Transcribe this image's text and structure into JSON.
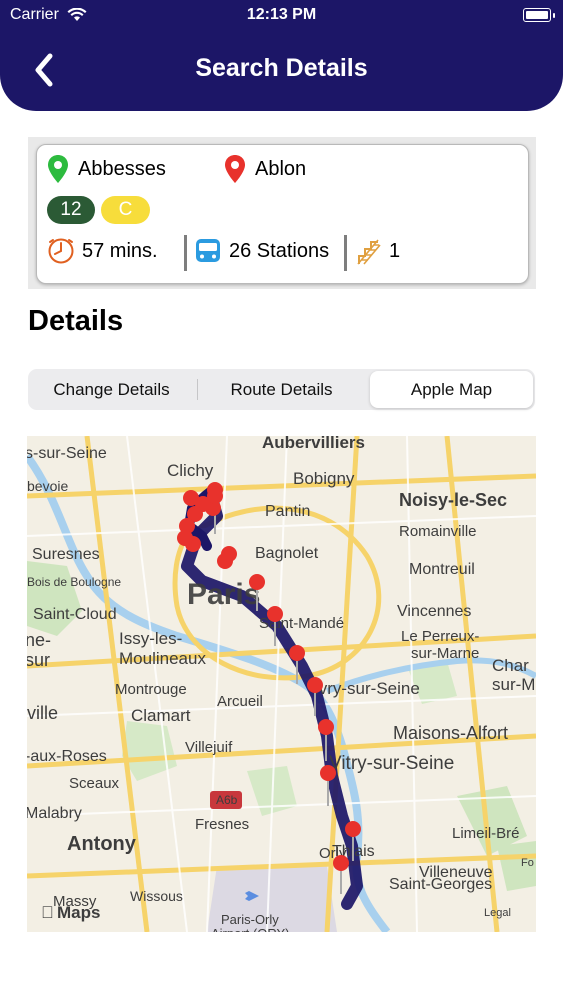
{
  "status_bar": {
    "carrier": "Carrier",
    "time": "12:13 PM"
  },
  "header": {
    "title": "Search Details"
  },
  "journey": {
    "from": "Abbesses",
    "to": "Ablon",
    "lines": [
      {
        "label": "12",
        "color": "#2b5a35"
      },
      {
        "label": "C",
        "color": "#f7dd3b"
      }
    ],
    "duration": "57 mins.",
    "stations": "26 Stations",
    "changes": "1"
  },
  "details": {
    "heading": "Details",
    "tabs": [
      {
        "label": "Change Details"
      },
      {
        "label": "Route Details"
      },
      {
        "label": "Apple Map",
        "selected": true
      }
    ]
  },
  "map": {
    "labels": {
      "aubervilliers": "Aubervilliers",
      "sur_seine": "s-sur-Seine",
      "clichy": "Clichy",
      "bobigny": "Bobigny",
      "bevoie": "bevoie",
      "noisy": "Noisy-le-Sec",
      "pantin": "Pantin",
      "romainville": "Romainville",
      "suresnes": "Suresnes",
      "bagnolet": "Bagnolet",
      "montreuil": "Montreuil",
      "bois": "Bois de Boulogne",
      "paris": "Paris",
      "saint_mande": "Saint-Mandé",
      "vincennes": "Vincennes",
      "saint_cloud": "Saint-Cloud",
      "issy1": "Issy-les-",
      "issy2": "Moulineaux",
      "le_perreux1": "Le Perreux-",
      "le_perreux2": "sur-Marne",
      "ne_sur1": "ne-",
      "ne_sur2": "sur",
      "cha1": "Char",
      "cha2": "sur-M",
      "montrouge": "Montrouge",
      "ivry": "Ivry-sur-Seine",
      "ville": "ville",
      "clamart": "Clamart",
      "arcueil": "Arcueil",
      "maisons": "Maisons-Alfort",
      "aux_roses": "-aux-Roses",
      "villejuif": "Villejuif",
      "vitry": "Vitry-sur-Seine",
      "sceaux": "Sceaux",
      "a6b": "A6b",
      "malabry": "Malabry",
      "fresnes": "Fresnes",
      "thiais": "Thiais",
      "limeil": "Limeil-Bré",
      "antony": "Antony",
      "orly": "Orly",
      "villeneuve1": "Villeneuve",
      "villeneuve2": "Saint-Georges",
      "massy": "Massy",
      "wissous": "Wissous",
      "paris_orly": "Paris-Orly",
      "airport": "Airport (ORY)",
      "maps": "Maps",
      "legal": "Legal",
      "fo": "Fo"
    },
    "route_color": "#1c1667",
    "pin_color": "#e8322c"
  }
}
